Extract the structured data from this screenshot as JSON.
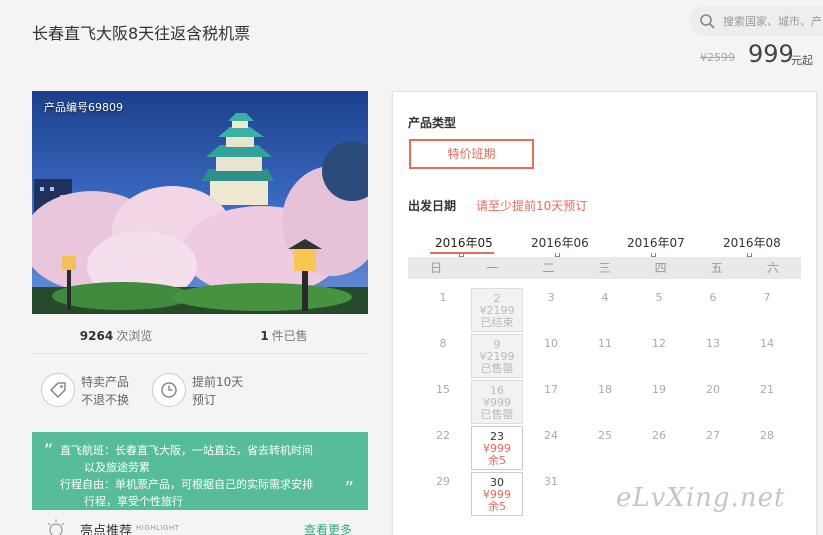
{
  "header": {
    "title": "长春直飞大阪8天往返含税机票",
    "search_placeholder": "搜索国家、城市、产",
    "price_original": "¥2599",
    "price_current": "999",
    "price_unit": "元起"
  },
  "product": {
    "code_label": "产品编号69809",
    "views_count": "9264",
    "views_label": "次浏览",
    "sold_count": "1",
    "sold_label": "件已售",
    "features": [
      {
        "line1": "特卖产品",
        "line2": "不退不换",
        "icon": "tag-icon"
      },
      {
        "line1": "提前10天",
        "line2": "预订",
        "icon": "clock-icon"
      }
    ],
    "highlight": {
      "line1": "直飞航班：长春直飞大阪，一站直达，省去转机时间",
      "line2": "以及旅途劳累",
      "line3": "行程自由：单机票产品，可根据自己的实际需求安排",
      "line4": "行程，享受个性旅行"
    },
    "recommend_label": "亮点推荐",
    "recommend_sub": "HIGHLIGHT",
    "more_label": "查看更多"
  },
  "booking": {
    "type_title": "产品类型",
    "type_option": "特价班期",
    "date_title": "出发日期",
    "date_notice": "请至少提前10天预订",
    "months": [
      "2016年05",
      "2016年06",
      "2016年07",
      "2016年08"
    ],
    "active_month": "2016年05",
    "weekdays": [
      "日",
      "一",
      "二",
      "三",
      "四",
      "五",
      "六"
    ],
    "rows": [
      [
        {
          "d": "1"
        },
        {
          "d": "2",
          "p": "¥2199",
          "s": "已结束",
          "st": "past"
        },
        {
          "d": "3"
        },
        {
          "d": "4"
        },
        {
          "d": "5"
        },
        {
          "d": "6"
        },
        {
          "d": "7"
        }
      ],
      [
        {
          "d": "8"
        },
        {
          "d": "9",
          "p": "¥2199",
          "s": "已售罄",
          "st": "past"
        },
        {
          "d": "10"
        },
        {
          "d": "11"
        },
        {
          "d": "12"
        },
        {
          "d": "13"
        },
        {
          "d": "14"
        }
      ],
      [
        {
          "d": "15"
        },
        {
          "d": "16",
          "p": "¥999",
          "s": "已售罄",
          "st": "past"
        },
        {
          "d": "17"
        },
        {
          "d": "18"
        },
        {
          "d": "19"
        },
        {
          "d": "20"
        },
        {
          "d": "21"
        }
      ],
      [
        {
          "d": "22"
        },
        {
          "d": "23",
          "p": "¥999",
          "s": "余5",
          "st": "avail"
        },
        {
          "d": "24"
        },
        {
          "d": "25"
        },
        {
          "d": "26"
        },
        {
          "d": "27"
        },
        {
          "d": "28"
        }
      ],
      [
        {
          "d": "29"
        },
        {
          "d": "30",
          "p": "¥999",
          "s": "余5",
          "st": "avail"
        },
        {
          "d": "31"
        }
      ]
    ]
  },
  "watermark": "eLvXing.net",
  "colors": {
    "accent": "#e86a5b",
    "green": "#56bd98"
  }
}
